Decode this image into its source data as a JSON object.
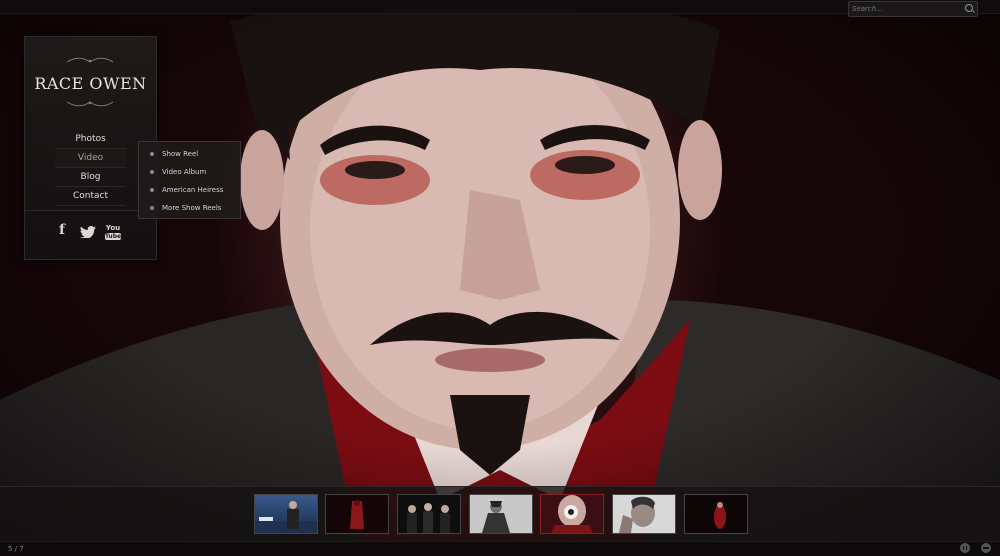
{
  "search": {
    "placeholder": "Search..."
  },
  "site": {
    "title": "RACE OWEN"
  },
  "nav": {
    "items": [
      {
        "label": "Photos"
      },
      {
        "label": "Video"
      },
      {
        "label": "Blog"
      },
      {
        "label": "Contact"
      }
    ]
  },
  "video_menu": {
    "items": [
      {
        "label": "Show Reel"
      },
      {
        "label": "Video Album"
      },
      {
        "label": "American Heiress"
      },
      {
        "label": "More Show Reels"
      }
    ]
  },
  "social": {
    "facebook": "f",
    "youtube_top": "You",
    "youtube_bottom": "Tube"
  },
  "gallery": {
    "counter": "5 / 7",
    "active_index": 5,
    "total": 7
  },
  "icons": [
    "search-icon",
    "facebook-icon",
    "twitter-icon",
    "youtube-icon",
    "eye-icon",
    "pause-icon",
    "minimize-icon"
  ],
  "colors": {
    "accent": "#8a2020",
    "panel": "#1a1616",
    "text": "#e0dcd8"
  }
}
